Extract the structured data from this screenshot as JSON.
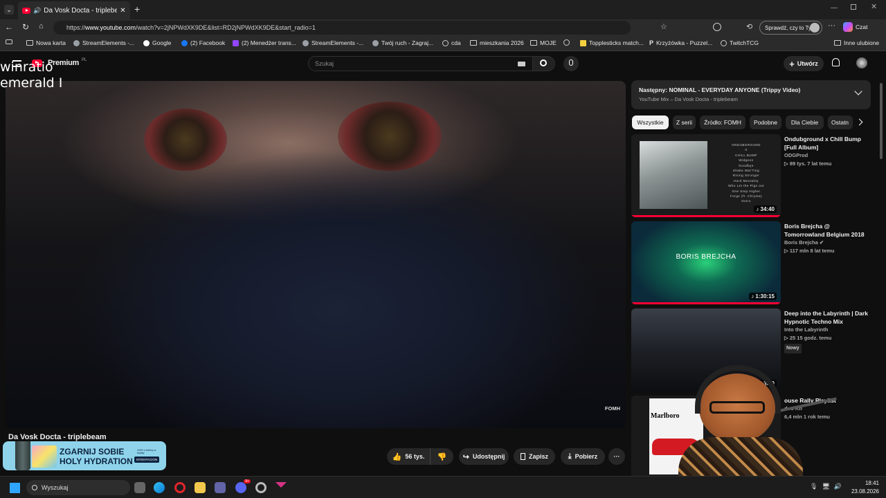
{
  "browser": {
    "tab": {
      "title": "Da Vosk Docta - triplebeam -"
    },
    "url_prefix": "https://",
    "url_host": "www.youtube.com",
    "url_path": "/watch?v=2jNPWdXK9DE&list=RD2jNPWdXK9DE&start_radio=1",
    "profile_button": "Sprawdź, czy to Ty",
    "copilot_label": "Czat",
    "bookmarks": [
      {
        "label": "Nowa karta"
      },
      {
        "label": "StreamElements -..."
      },
      {
        "label": "Google"
      },
      {
        "label": "(2) Facebook"
      },
      {
        "label": "(2) Menedżer trans..."
      },
      {
        "label": "StreamElements -..."
      },
      {
        "label": "Twój ruch - Zagraj..."
      },
      {
        "label": "cda"
      },
      {
        "label": "mieszkania 2026"
      },
      {
        "label": "MOJE"
      },
      {
        "label": ""
      },
      {
        "label": "Topplesticks match..."
      },
      {
        "label": "Krzyżówka - Puzzel..."
      },
      {
        "label": "TwitchTCG"
      }
    ],
    "other_bookmarks": "Inne ulubione"
  },
  "youtube": {
    "logo_text": "Premium",
    "logo_country": "PL",
    "search_placeholder": "Szukaj",
    "create_label": "Utwórz",
    "video": {
      "watermark": "FOMH",
      "title": "Da Vosk Docta - triplebeam",
      "likes": "56 tys.",
      "share_label": "Udostępnij",
      "save_label": "Zapisz",
      "download_label": "Pobierz"
    },
    "next_up": {
      "title": "Następny: NOMINAL - EVERYDAY ANYONE (Trippy Video)",
      "subtitle": "YouTube Mix – Da Vosk Docta - triplebeam"
    },
    "chips": [
      "Wszystkie",
      "Z serii",
      "Źródło: FOMH",
      "Podobne",
      "Dla Ciebie",
      "Ostatn"
    ],
    "recommendations": [
      {
        "title": "Ondubground x Chill Bump [Full Album]",
        "channel": "ODGProd",
        "stats": "89 tys.   7 lat temu",
        "duration": "34:40",
        "badge": "",
        "verified": false
      },
      {
        "title": "Boris Brejcha @ Tomorrowland Belgium 2018",
        "channel": "Boris Brejcha",
        "stats": "117 mln   8 lat temu",
        "duration": "1:30:15",
        "badge": "",
        "verified": true,
        "thumb_text": "BORIS BREJCHA"
      },
      {
        "title": "Deep into the Labyrinth | Dark Hypnotic Techno Mix",
        "channel": "Into the Labyrinth",
        "stats": "25   15 godz. temu",
        "duration": "35:0",
        "badge": "Nowy",
        "verified": false
      },
      {
        "title": "ouse Rally Playlist",
        "channel": "doo Kn",
        "stats": "6,4 mln   1 rok temu",
        "duration": "",
        "badge": "",
        "verified": false
      }
    ],
    "album_thumb_lines": [
      "ONDUBGROUND",
      "X",
      "CHILL BUMP",
      "Widgeon",
      "Goodbye",
      "Shake Wat'Ting",
      "Rising Stronger",
      "Hard Mentality",
      "Who Let the Pigs out",
      "One Step Higher",
      "Forge (ft. Chrysta)",
      "Outro"
    ]
  },
  "stream_overlay": {
    "text_line1": "winratio",
    "text_line2": "emerald I",
    "ad_line1": "ZGARNIJ SOBIE",
    "ad_line2": "HOLY HYDRATION",
    "ad_badge": "INTENTACION",
    "ad_small": "100% z kofeiny w karaby",
    "poster_brand": "Marlboro"
  },
  "taskbar": {
    "search_label": "Wyszukaj",
    "time": "18:41",
    "date": "23.08.2026",
    "discord_badge": "9+"
  },
  "colors": {
    "accent": "#ff0033",
    "bg": "#0f0f0f",
    "chip_bg": "#272727"
  }
}
